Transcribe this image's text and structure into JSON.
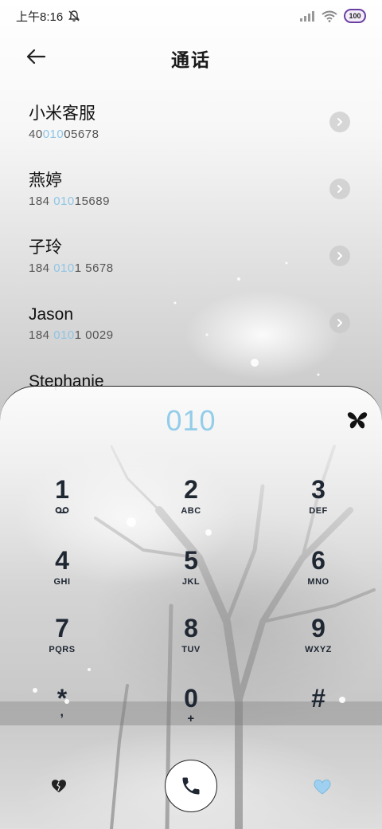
{
  "status_bar": {
    "time": "上午8:16",
    "battery": "100"
  },
  "header": {
    "title": "通话"
  },
  "contacts": [
    {
      "name": "小米客服",
      "number_pre": "40",
      "number_hl": "010",
      "number_post": "05678"
    },
    {
      "name": "燕婷",
      "number_pre": "184 ",
      "number_hl": "010",
      "number_post": "15689"
    },
    {
      "name": "子玲",
      "number_pre": "184 ",
      "number_hl": "010",
      "number_post": "1 5678"
    },
    {
      "name": "Jason",
      "number_pre": "184 ",
      "number_hl": "010",
      "number_post": "1 0029"
    },
    {
      "name": "Stephanie"
    }
  ],
  "dialer": {
    "input": "010",
    "keys": [
      {
        "digit": "1",
        "letters": "voicemail"
      },
      {
        "digit": "2",
        "letters": "ABC"
      },
      {
        "digit": "3",
        "letters": "DEF"
      },
      {
        "digit": "4",
        "letters": "GHI"
      },
      {
        "digit": "5",
        "letters": "JKL"
      },
      {
        "digit": "6",
        "letters": "MNO"
      },
      {
        "digit": "7",
        "letters": "PQRS"
      },
      {
        "digit": "8",
        "letters": "TUV"
      },
      {
        "digit": "9",
        "letters": "WXYZ"
      },
      {
        "digit": "*",
        "letters": ","
      },
      {
        "digit": "0",
        "letters": "+"
      },
      {
        "digit": "#",
        "letters": ""
      }
    ]
  },
  "icons": {
    "back": "arrow-left-icon",
    "chevron": "chevron-right-icon",
    "butterfly": "butterfly-icon",
    "call": "phone-icon",
    "left_action": "broken-heart-icon",
    "right_action": "blue-heart-icon"
  },
  "colors": {
    "highlight": "#8fc5e6",
    "dial_input": "#93cdea",
    "key_text": "#1f2733"
  }
}
